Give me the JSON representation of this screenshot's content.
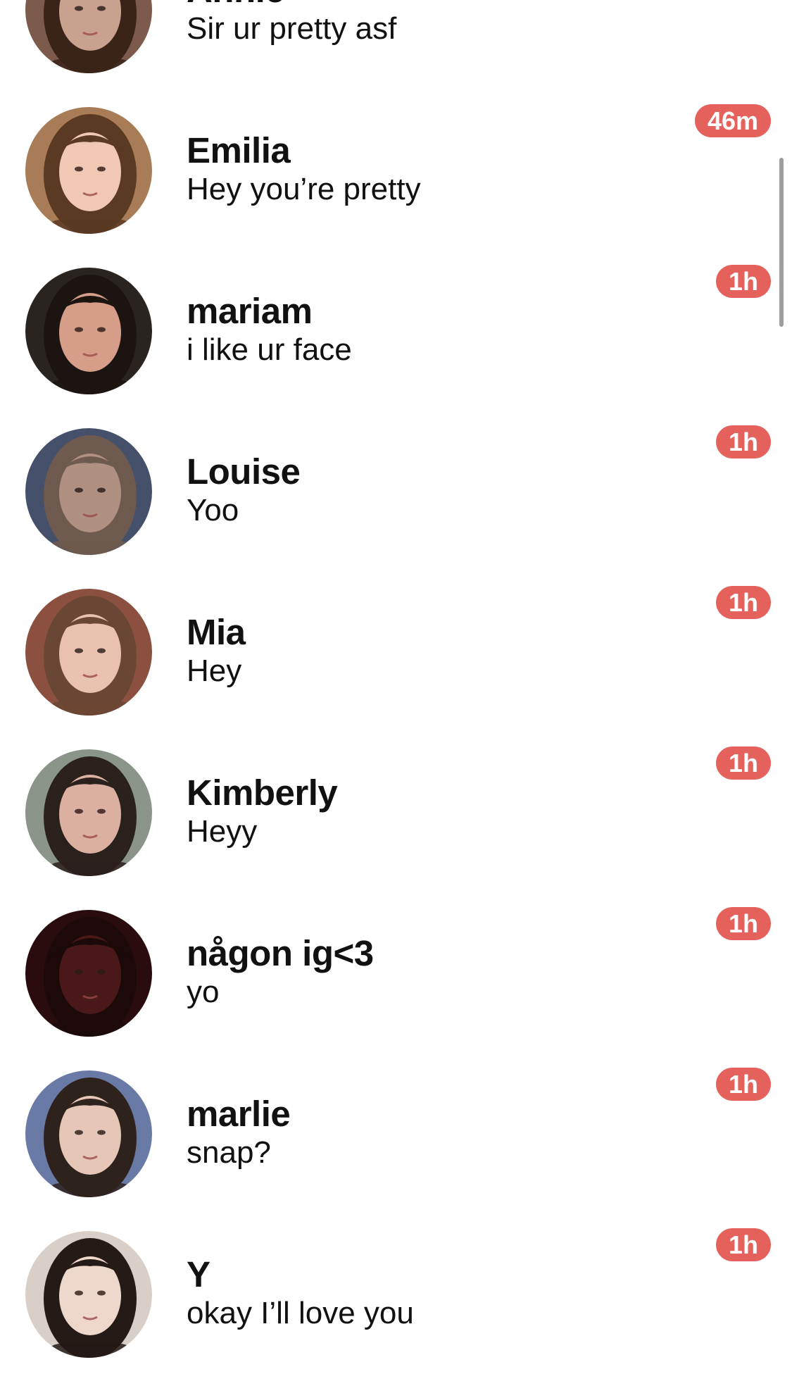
{
  "theme": {
    "badge_color": "#e5615c",
    "text_color": "#111111",
    "background": "#ffffff"
  },
  "conversations": [
    {
      "name": "Annie",
      "message": "Sir ur pretty asf",
      "time": "",
      "avatar": "annie-avatar",
      "skin": "#c9a28f",
      "hair": "#3a2418",
      "bg": "#7c5a4c"
    },
    {
      "name": "Emilia",
      "message": "Hey you’re pretty",
      "time": "46m",
      "avatar": "emilia-avatar",
      "skin": "#f0c8b4",
      "hair": "#5a3a22",
      "bg": "#a87c56"
    },
    {
      "name": "mariam",
      "message": "i like ur face",
      "time": "1h",
      "avatar": "mariam-avatar",
      "skin": "#d69e88",
      "hair": "#1c1410",
      "bg": "#2a2420"
    },
    {
      "name": "Louise",
      "message": "Yoo",
      "time": "1h",
      "avatar": "louise-avatar",
      "skin": "#b09080",
      "hair": "#6e5a4e",
      "bg": "#45506a"
    },
    {
      "name": "Mia",
      "message": "Hey",
      "time": "1h",
      "avatar": "mia-avatar",
      "skin": "#e8c2ae",
      "hair": "#6a4634",
      "bg": "#8c5040"
    },
    {
      "name": "Kimberly",
      "message": "Heyy",
      "time": "1h",
      "avatar": "kimberly-avatar",
      "skin": "#dcb0a0",
      "hair": "#2a201c",
      "bg": "#8a9488"
    },
    {
      "name": "någon ig<3",
      "message": "yo",
      "time": "1h",
      "avatar": "nagon-avatar",
      "skin": "#4a1818",
      "hair": "#1c0a0a",
      "bg": "#2a0c0e"
    },
    {
      "name": "marlie",
      "message": "snap?",
      "time": "1h",
      "avatar": "marlie-avatar",
      "skin": "#e6c6b6",
      "hair": "#2e221c",
      "bg": "#6a7aa6"
    },
    {
      "name": "Y",
      "message": "okay I’ll love you",
      "time": "1h",
      "avatar": "y-avatar",
      "skin": "#eed8cc",
      "hair": "#241a16",
      "bg": "#d8d0c8"
    }
  ]
}
